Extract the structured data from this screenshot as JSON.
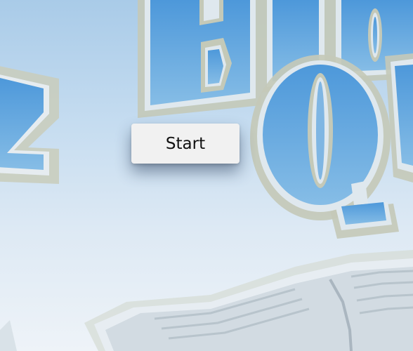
{
  "start_button": {
    "label": "Start"
  },
  "background": {
    "logo_letters": [
      "B",
      "i",
      "b",
      "Q",
      "u",
      "z"
    ],
    "colors": {
      "sky_top": "#a9cbe8",
      "sky_bottom": "#eef3f8",
      "letter_fill": "#5fa2dc",
      "letter_outline": "#c4c9b8",
      "book_fill": "#d2dbe2"
    }
  }
}
